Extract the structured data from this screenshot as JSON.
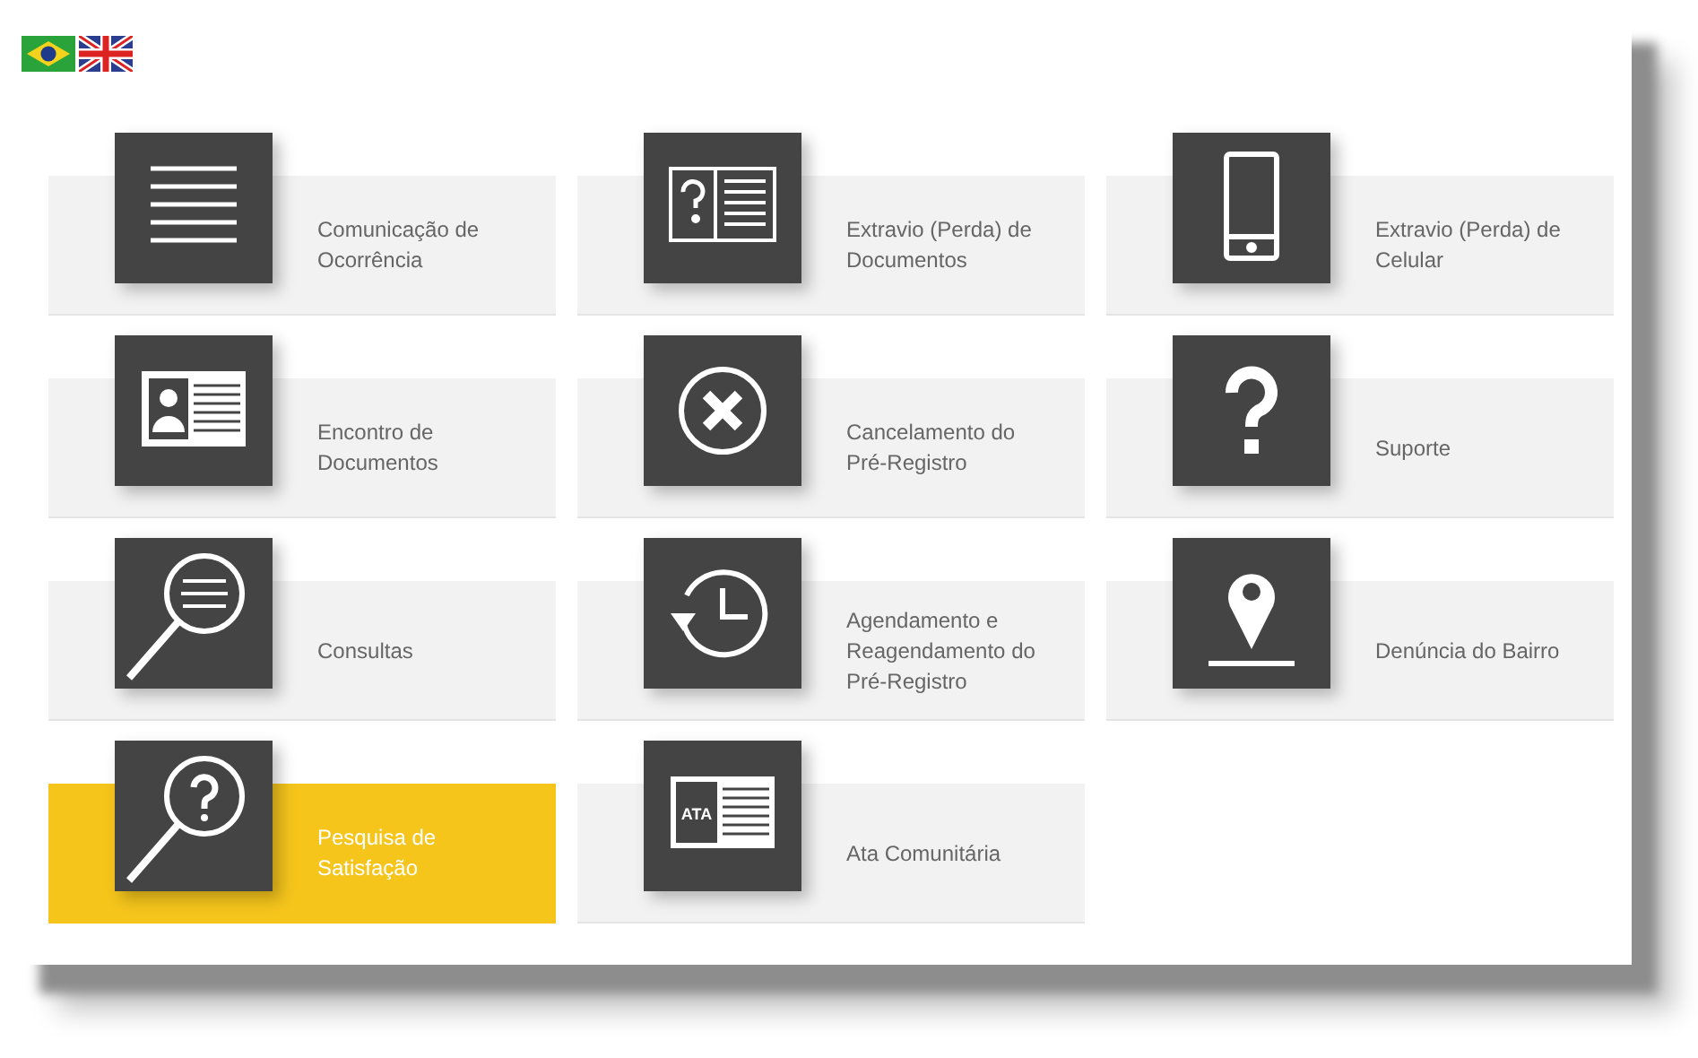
{
  "languages": [
    {
      "kind": "brazil"
    },
    {
      "kind": "uk"
    }
  ],
  "tiles": [
    {
      "label": "Comunicação de Ocorrência",
      "kind": "lines",
      "selected": false
    },
    {
      "label": "Extravio (Perda) de Documentos",
      "kind": "doc-question",
      "selected": false
    },
    {
      "label": "Extravio (Perda) de Celular",
      "kind": "phone",
      "selected": false
    },
    {
      "label": "Encontro de Documentos",
      "kind": "id-card",
      "selected": false
    },
    {
      "label": "Cancelamento do Pré-Registro",
      "kind": "x-circle",
      "selected": false
    },
    {
      "label": "Suporte",
      "kind": "question",
      "selected": false
    },
    {
      "label": "Consultas",
      "kind": "search-lines",
      "selected": false
    },
    {
      "label": "Agendamento e Reagendamento do Pré-Registro",
      "kind": "clock-back",
      "selected": false
    },
    {
      "label": "Denúncia do Bairro",
      "kind": "pin",
      "selected": false
    },
    {
      "label": "Pesquisa de Satisfação",
      "kind": "search-question",
      "selected": true
    },
    {
      "label": "Ata Comunitária",
      "kind": "doc-label",
      "icon_text": "ATA",
      "selected": false
    }
  ]
}
